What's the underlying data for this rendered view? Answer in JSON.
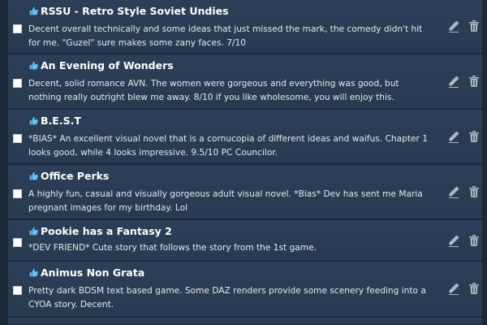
{
  "reviews": [
    {
      "title": "RSSU - Retro Style Soviet Undies",
      "description": "Decent overall technically and some ideas that just missed the mark, the comedy didn't hit for me. \"Guzel\" sure makes some zany faces. 7/10"
    },
    {
      "title": "An Evening of Wonders",
      "description": "Decent, solid romance AVN. The women were gorgeous and everything was good, but nothing really outright blew me away. 8/10 if you like wholesome, you will enjoy this."
    },
    {
      "title": "B.E.S.T",
      "description": "*BIAS* An excellent visual novel that is a cornucopia of different ideas and waifus. Chapter 1 looks good, while 4 looks impressive. 9.5/10 PC Councilor."
    },
    {
      "title": "Office Perks",
      "description": "A highly fun, casual and visually gorgeous adult visual novel. *Bias* Dev has sent me Maria pregnant images for my birthday. Lol"
    },
    {
      "title": "Pookie has a Fantasy 2",
      "description": "*DEV FRIEND* Cute story that follows the story from the 1st game."
    },
    {
      "title": "Animus Non Grata",
      "description": "Pretty dark BDSM text based game. Some DAZ renders provide some scenery feeding into a CYOA story. Decent."
    }
  ],
  "icons": {
    "recommended": "thumbs-up-icon",
    "edit": "pencil-icon",
    "delete": "trash-icon"
  },
  "colors": {
    "background": "#1b2838",
    "row": "#2a3f5a",
    "accent": "#66c0f4",
    "icon": "#aeb7c0"
  }
}
